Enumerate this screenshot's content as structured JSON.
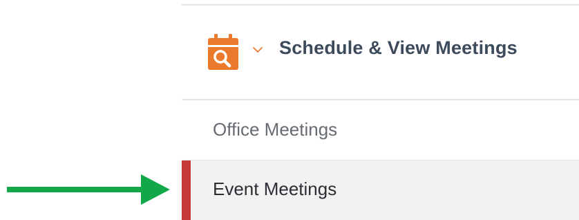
{
  "section": {
    "title": "Schedule & View Meetings",
    "icon": "calendar-search-icon",
    "toggle_icon": "chevron-down-icon",
    "expanded": true
  },
  "menu": {
    "items": [
      {
        "label": "Office Meetings",
        "active": false
      },
      {
        "label": "Event Meetings",
        "active": true
      }
    ]
  },
  "annotation": {
    "icon": "arrow-right-icon",
    "color": "#12a84a"
  },
  "colors": {
    "accent_orange": "#ec7a2c",
    "active_indicator": "#c8393a",
    "title_text": "#3d4a5c",
    "active_background": "#f2f2f2"
  }
}
